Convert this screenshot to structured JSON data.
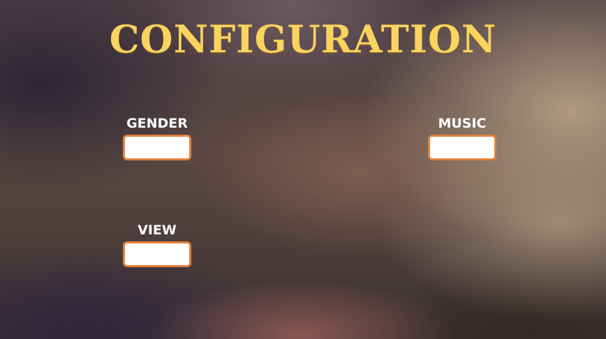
{
  "screen": {
    "title": "CONFIGURATION"
  },
  "fields": {
    "gender": {
      "label": "GENDER",
      "value": ""
    },
    "music": {
      "label": "MUSIC",
      "value": ""
    },
    "view": {
      "label": "VIEW",
      "value": ""
    }
  },
  "colors": {
    "title": "#f9d35e",
    "field_border": "#e3813a",
    "label": "#ffffff"
  }
}
